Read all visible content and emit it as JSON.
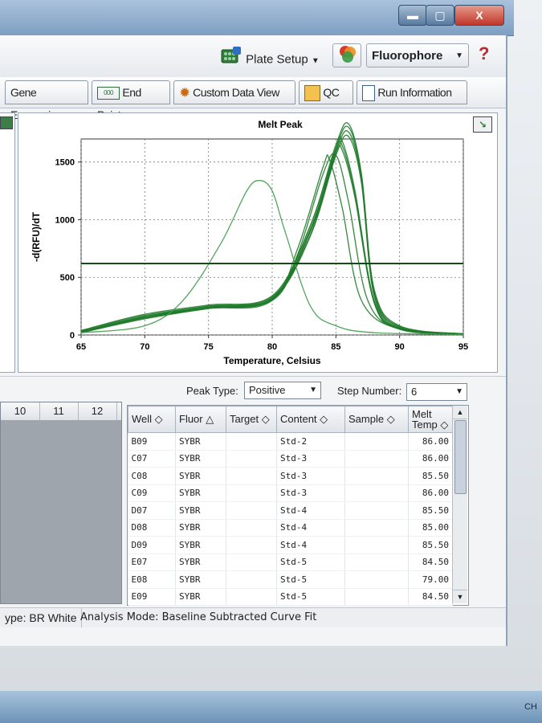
{
  "window": {
    "min_label": "▬",
    "max_label": "▢",
    "close_label": "X"
  },
  "toolbar": {
    "plate_setup": "Plate Setup",
    "fluorophore": "Fluorophore",
    "help": "?"
  },
  "tabs": [
    {
      "label": "Gene Expression"
    },
    {
      "label": "End Point"
    },
    {
      "label": "Custom Data View"
    },
    {
      "label": "QC"
    },
    {
      "label": "Run Information"
    }
  ],
  "chart_data": {
    "type": "line",
    "title": "Melt Peak",
    "xlabel": "Temperature, Celsius",
    "ylabel": "-d(RFU)/dT",
    "xlim": [
      65,
      95
    ],
    "ylim": [
      0,
      1700
    ],
    "xticks": [
      "65",
      "70",
      "75",
      "80",
      "85",
      "90",
      "95"
    ],
    "yticks": [
      "0",
      "500",
      "1000",
      "1500"
    ],
    "threshold": 620,
    "grid": true,
    "series": [
      {
        "tm": 86.0,
        "peak": 1830,
        "x": [
          65,
          70,
          75,
          80,
          83,
          85,
          86,
          87,
          88,
          90,
          95
        ],
        "y": [
          40,
          180,
          260,
          340,
          950,
          1650,
          1830,
          1400,
          400,
          80,
          10
        ]
      },
      {
        "tm": 86.0,
        "peak": 1800,
        "x": [
          65,
          70,
          75,
          80,
          83,
          85,
          86,
          87,
          88,
          90,
          95
        ],
        "y": [
          35,
          170,
          250,
          330,
          900,
          1620,
          1800,
          1380,
          380,
          70,
          10
        ]
      },
      {
        "tm": 86.0,
        "peak": 1760,
        "x": [
          65,
          70,
          75,
          80,
          83,
          85,
          86,
          87,
          88,
          90,
          95
        ],
        "y": [
          30,
          160,
          240,
          320,
          870,
          1590,
          1760,
          1350,
          360,
          70,
          10
        ]
      },
      {
        "tm": 86.0,
        "peak": 1720,
        "x": [
          65,
          70,
          75,
          80,
          83,
          85,
          86,
          87,
          88,
          90,
          95
        ],
        "y": [
          30,
          150,
          230,
          310,
          860,
          1560,
          1720,
          1320,
          340,
          60,
          10
        ]
      },
      {
        "tm": 85.5,
        "peak": 1680,
        "x": [
          65,
          70,
          75,
          80,
          83,
          85,
          85.5,
          86.5,
          88,
          90,
          95
        ],
        "y": [
          25,
          160,
          250,
          320,
          950,
          1620,
          1680,
          1250,
          300,
          60,
          10
        ]
      },
      {
        "tm": 85.5,
        "peak": 1640,
        "x": [
          65,
          70,
          75,
          80,
          83,
          85,
          85.5,
          86.5,
          88,
          90,
          95
        ],
        "y": [
          25,
          150,
          240,
          310,
          920,
          1590,
          1640,
          1220,
          290,
          60,
          10
        ]
      },
      {
        "tm": 85.5,
        "peak": 1600,
        "x": [
          65,
          70,
          75,
          80,
          83,
          85,
          85.5,
          86.5,
          88,
          90,
          95
        ],
        "y": [
          20,
          140,
          230,
          300,
          900,
          1560,
          1600,
          1190,
          280,
          50,
          10
        ]
      },
      {
        "tm": 85.0,
        "peak": 1560,
        "x": [
          65,
          70,
          75,
          80,
          82,
          84,
          85,
          86,
          87.5,
          90,
          95
        ],
        "y": [
          20,
          150,
          240,
          300,
          700,
          1400,
          1560,
          1150,
          300,
          50,
          10
        ]
      },
      {
        "tm": 84.5,
        "peak": 1520,
        "x": [
          65,
          70,
          75,
          80,
          82,
          84,
          84.5,
          85.5,
          87,
          90,
          95
        ],
        "y": [
          20,
          150,
          240,
          310,
          750,
          1460,
          1520,
          1100,
          300,
          50,
          10
        ]
      },
      {
        "tm": 79.0,
        "peak": 1340,
        "x": [
          65,
          70,
          73,
          76,
          78,
          79,
          80,
          81,
          83,
          85,
          88,
          95
        ],
        "y": [
          20,
          80,
          300,
          800,
          1250,
          1340,
          1250,
          900,
          250,
          80,
          20,
          5
        ]
      }
    ]
  },
  "peak": {
    "type_label": "Peak Type:",
    "type_value": "Positive",
    "step_label": "Step Number:",
    "step_value": "6"
  },
  "plate_columns": [
    "10",
    "11",
    "12"
  ],
  "table": {
    "headers": [
      "Well",
      "Fluor",
      "Target",
      "Content",
      "Sample",
      "Melt Temp"
    ],
    "rows": [
      [
        "B09",
        "SYBR",
        "",
        "Std-2",
        "",
        "86.00"
      ],
      [
        "C07",
        "SYBR",
        "",
        "Std-3",
        "",
        "86.00"
      ],
      [
        "C08",
        "SYBR",
        "",
        "Std-3",
        "",
        "85.50"
      ],
      [
        "C09",
        "SYBR",
        "",
        "Std-3",
        "",
        "86.00"
      ],
      [
        "D07",
        "SYBR",
        "",
        "Std-4",
        "",
        "85.50"
      ],
      [
        "D08",
        "SYBR",
        "",
        "Std-4",
        "",
        "85.00"
      ],
      [
        "D09",
        "SYBR",
        "",
        "Std-4",
        "",
        "85.50"
      ],
      [
        "E07",
        "SYBR",
        "",
        "Std-5",
        "",
        "84.50"
      ],
      [
        "E08",
        "SYBR",
        "",
        "Std-5",
        "",
        "79.00"
      ],
      [
        "E09",
        "SYBR",
        "",
        "Std-5",
        "",
        "84.50"
      ]
    ]
  },
  "status": {
    "plate_type": "ype: BR White",
    "analysis_mode": "Analysis Mode: Baseline Subtracted Curve Fit"
  },
  "colors": {
    "curve": "#1f7a2a",
    "threshold": "#0f4f16",
    "accent": "#2d5a8c"
  }
}
